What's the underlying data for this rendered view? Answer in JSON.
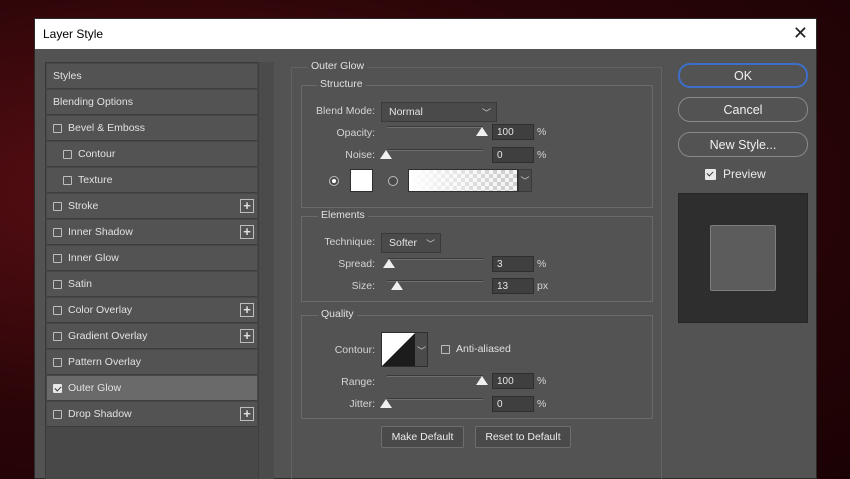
{
  "dialog": {
    "title": "Layer Style"
  },
  "left_list": {
    "items": [
      {
        "label": "Styles",
        "checkbox": false,
        "checked": false,
        "plus": false,
        "indent": false,
        "active": false
      },
      {
        "label": "Blending Options",
        "checkbox": false,
        "checked": false,
        "plus": false,
        "indent": false,
        "active": false
      },
      {
        "label": "Bevel & Emboss",
        "checkbox": true,
        "checked": false,
        "plus": false,
        "indent": false,
        "active": false
      },
      {
        "label": "Contour",
        "checkbox": true,
        "checked": false,
        "plus": false,
        "indent": true,
        "active": false
      },
      {
        "label": "Texture",
        "checkbox": true,
        "checked": false,
        "plus": false,
        "indent": true,
        "active": false
      },
      {
        "label": "Stroke",
        "checkbox": true,
        "checked": false,
        "plus": true,
        "indent": false,
        "active": false
      },
      {
        "label": "Inner Shadow",
        "checkbox": true,
        "checked": false,
        "plus": true,
        "indent": false,
        "active": false
      },
      {
        "label": "Inner Glow",
        "checkbox": true,
        "checked": false,
        "plus": false,
        "indent": false,
        "active": false
      },
      {
        "label": "Satin",
        "checkbox": true,
        "checked": false,
        "plus": false,
        "indent": false,
        "active": false
      },
      {
        "label": "Color Overlay",
        "checkbox": true,
        "checked": false,
        "plus": true,
        "indent": false,
        "active": false
      },
      {
        "label": "Gradient Overlay",
        "checkbox": true,
        "checked": false,
        "plus": true,
        "indent": false,
        "active": false
      },
      {
        "label": "Pattern Overlay",
        "checkbox": true,
        "checked": false,
        "plus": false,
        "indent": false,
        "active": false
      },
      {
        "label": "Outer Glow",
        "checkbox": true,
        "checked": true,
        "plus": false,
        "indent": false,
        "active": true
      },
      {
        "label": "Drop Shadow",
        "checkbox": true,
        "checked": false,
        "plus": true,
        "indent": false,
        "active": false
      }
    ],
    "plus_glyph": "+"
  },
  "outer_glow": {
    "title": "Outer Glow",
    "structure": {
      "title": "Structure",
      "blend_mode_label": "Blend Mode:",
      "blend_mode_value": "Normal",
      "opacity_label": "Opacity:",
      "opacity_value": "100",
      "noise_label": "Noise:",
      "noise_value": "0",
      "percent": "%",
      "color_swatch": "#ffffff"
    },
    "elements": {
      "title": "Elements",
      "technique_label": "Technique:",
      "technique_value": "Softer",
      "spread_label": "Spread:",
      "spread_value": "3",
      "size_label": "Size:",
      "size_value": "13",
      "percent": "%",
      "px": "px"
    },
    "quality": {
      "title": "Quality",
      "contour_label": "Contour:",
      "anti_aliased_label": "Anti-aliased",
      "range_label": "Range:",
      "range_value": "100",
      "jitter_label": "Jitter:",
      "jitter_value": "0",
      "percent": "%"
    },
    "make_default_label": "Make Default",
    "reset_default_label": "Reset to Default"
  },
  "right": {
    "ok_label": "OK",
    "cancel_label": "Cancel",
    "new_style_label": "New Style...",
    "preview_label": "Preview",
    "preview_checked": true
  },
  "colors": {
    "accent": "#3e6fc8",
    "dialog_bg": "#535353"
  }
}
